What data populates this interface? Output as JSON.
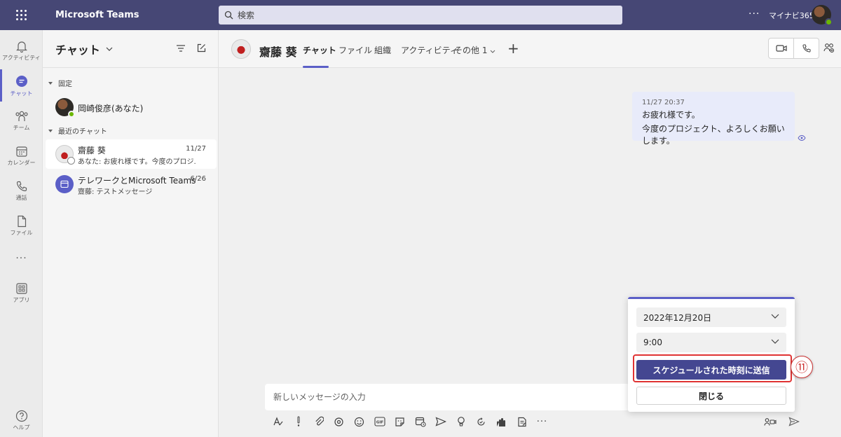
{
  "app": {
    "title": "Microsoft Teams",
    "org_name": "マイナビ365"
  },
  "search": {
    "placeholder": "検索"
  },
  "rail": {
    "items": [
      {
        "label": "アクティビティ",
        "icon": "bell-icon"
      },
      {
        "label": "チャット",
        "icon": "chat-icon"
      },
      {
        "label": "チーム",
        "icon": "teams-icon"
      },
      {
        "label": "カレンダー",
        "icon": "calendar-icon"
      },
      {
        "label": "通話",
        "icon": "phone-icon"
      },
      {
        "label": "ファイル",
        "icon": "file-icon"
      },
      {
        "label": "アプリ",
        "icon": "apps-icon"
      },
      {
        "label": "ヘルプ",
        "icon": "help-icon"
      }
    ]
  },
  "chatlist": {
    "title": "チャット",
    "pinned_label": "固定",
    "recent_label": "最近のチャット",
    "pinned": [
      {
        "name": "岡崎俊彦(あなた)"
      }
    ],
    "recent": [
      {
        "name": "齋藤 葵",
        "date": "11/27",
        "preview": "あなた: お疲れ様です。今度のプロジ..."
      },
      {
        "name": "テレワークとMicrosoft Teams",
        "date": "6/26",
        "preview": "齋藤: テストメッセージ"
      }
    ]
  },
  "conversation": {
    "name": "齋藤 葵",
    "tabs": [
      "チャット",
      "ファイル",
      "組織",
      "アクティビティ",
      "その他 1"
    ],
    "message": {
      "timestamp": "11/27 20:37",
      "lines": [
        "お疲れ様です。",
        "今度のプロジェクト、よろしくお願いします。"
      ]
    },
    "composer_placeholder": "新しいメッセージの入力"
  },
  "schedule_popup": {
    "date": "2022年12月20日",
    "time": "9:00",
    "send_label": "スケジュールされた時刻に送信",
    "close_label": "閉じる",
    "step_marker": "⑪"
  },
  "colors": {
    "header": "#464775",
    "accent": "#5b5fc7",
    "button": "#444791",
    "highlight": "#e03333"
  }
}
